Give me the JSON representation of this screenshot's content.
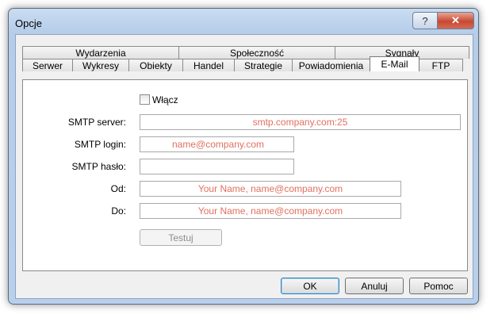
{
  "window": {
    "title": "Opcje",
    "help_label": "?",
    "close_label": "✕"
  },
  "tabs_row1": [
    "Wydarzenia",
    "Społeczność",
    "Sygnały"
  ],
  "tabs_row2": [
    "Serwer",
    "Wykresy",
    "Obiekty",
    "Handel",
    "Strategie",
    "Powiadomienia",
    "E-Mail",
    "FTP"
  ],
  "active_tab": "E-Mail",
  "email": {
    "enable_label": "Włącz",
    "enabled": false,
    "smtp_server_label": "SMTP server:",
    "smtp_server_value": "smtp.company.com:25",
    "smtp_login_label": "SMTP login:",
    "smtp_login_value": "name@company.com",
    "smtp_password_label": "SMTP hasło:",
    "smtp_password_value": "",
    "from_label": "Od:",
    "from_value": "Your Name, name@company.com",
    "to_label": "Do:",
    "to_value": "Your Name, name@company.com",
    "test_label": "Testuj"
  },
  "buttons": {
    "ok": "OK",
    "cancel": "Anuluj",
    "help": "Pomoc"
  },
  "colors": {
    "placeholder_text": "#e07060",
    "title_bar": "#b9d0ec",
    "close_button": "#c74a33"
  }
}
